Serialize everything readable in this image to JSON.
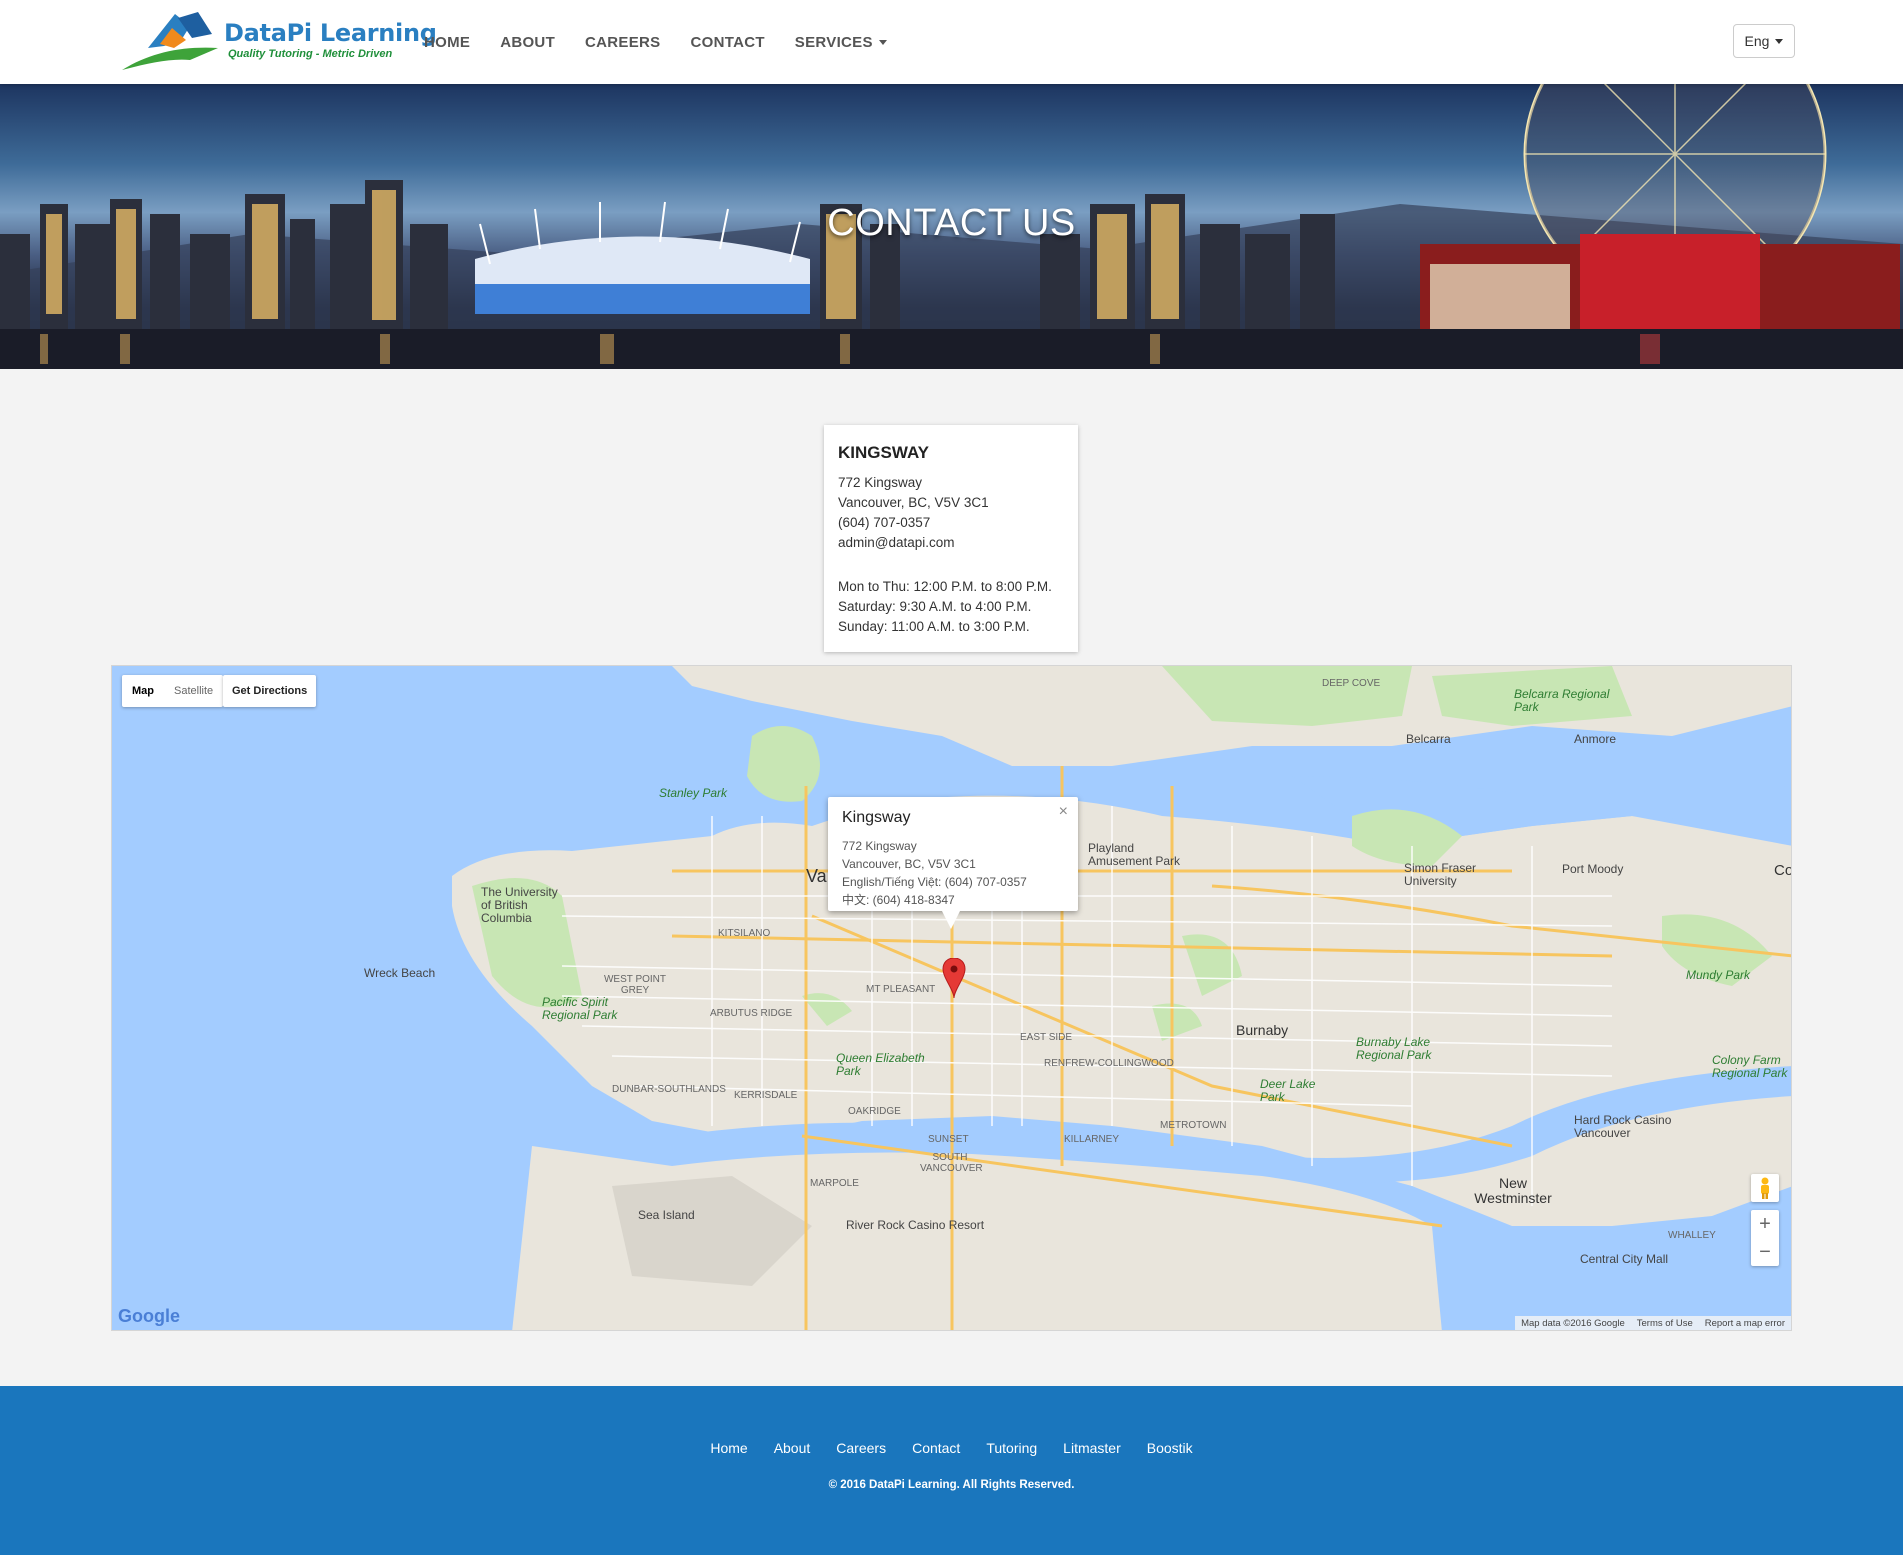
{
  "brand": {
    "name": "DataPi Learning",
    "tagline": "Quality Tutoring - Metric Driven"
  },
  "nav": {
    "items": [
      "HOME",
      "ABOUT",
      "CAREERS",
      "CONTACT",
      "SERVICES"
    ],
    "language": "Eng"
  },
  "hero": {
    "title": "CONTACT US"
  },
  "contact_card": {
    "title": "KINGSWAY",
    "address1": "772 Kingsway",
    "address2": "Vancouver, BC, V5V 3C1",
    "phone": "(604) 707-0357",
    "email": "admin@datapi.com",
    "hours": [
      "Mon to Thu: 12:00 P.M. to 8:00 P.M.",
      "Saturday: 9:30 A.M. to 4:00 P.M.",
      "Sunday: 11:00 A.M. to 3:00 P.M."
    ]
  },
  "map": {
    "type_map": "Map",
    "type_satellite": "Satellite",
    "directions": "Get Directions",
    "info": {
      "title": "Kingsway",
      "address1": "772 Kingsway",
      "address2": "Vancouver, BC, V5V 3C1",
      "english_phone": "English/Tiếng Việt: (604) 707-0357",
      "chinese_phone": "中文: (604) 418-8347",
      "close": "×"
    },
    "labels": {
      "stanley_park": "Stanley Park",
      "ubc": "The University of British Columbia",
      "wreck_beach": "Wreck Beach",
      "pacific_spirit": "Pacific Spirit Regional Park",
      "queen_elizabeth": "Queen Elizabeth Park",
      "burnaby": "Burnaby",
      "burnaby_lake": "Burnaby Lake Regional Park",
      "deer_lake": "Deer Lake Park",
      "playland": "Playland Amusement Park",
      "sfu": "Simon Fraser University",
      "port_moody": "Port Moody",
      "belcarra": "Belcarra",
      "belcarra_park": "Belcarra Regional Park",
      "anmore": "Anmore",
      "mundy_park": "Mundy Park",
      "colony_farm": "Colony Farm Regional Park",
      "hard_rock": "Hard Rock Casino Vancouver",
      "new_westminster": "New Westminster",
      "central_city": "Central City Mall",
      "sea_island": "Sea Island",
      "river_rock": "River Rock Casino Resort",
      "metrotown": "METROTOWN",
      "kitsilano": "KITSILANO",
      "dunbar": "DUNBAR-SOUTHLANDS",
      "kerrisdale": "KERRISDALE",
      "oakridge": "OAKRIDGE",
      "marpole": "MARPOLE",
      "sunset": "SUNSET",
      "killarney": "KILLARNEY",
      "mt_pleasant": "MT PLEASANT",
      "east_side": "EAST SIDE",
      "renfrew": "RENFREW-COLLINGWOOD",
      "arbutus": "ARBUTUS RIDGE",
      "west_point_grey": "WEST POINT GREY",
      "south_vancouver": "SOUTH VANCOUVER",
      "deep_cove": "DEEP COVE",
      "whalley": "WHALLEY",
      "va": "Va",
      "co": "Co"
    },
    "zoom_in": "+",
    "zoom_out": "−",
    "google": "Google",
    "attribution": [
      "Map data ©2016 Google",
      "Terms of Use",
      "Report a map error"
    ]
  },
  "footer": {
    "links": [
      "Home",
      "About",
      "Careers",
      "Contact",
      "Tutoring",
      "Litmaster",
      "Boostik"
    ],
    "copyright": "© 2016 DataPi Learning. All Rights Reserved."
  },
  "colors": {
    "footer_bg": "#1a76bd",
    "brand_blue": "#2a7fc1",
    "brand_green": "#1f8f3a",
    "water": "#a3ccff",
    "land": "#e9e5dc",
    "park": "#c8e6b4"
  }
}
